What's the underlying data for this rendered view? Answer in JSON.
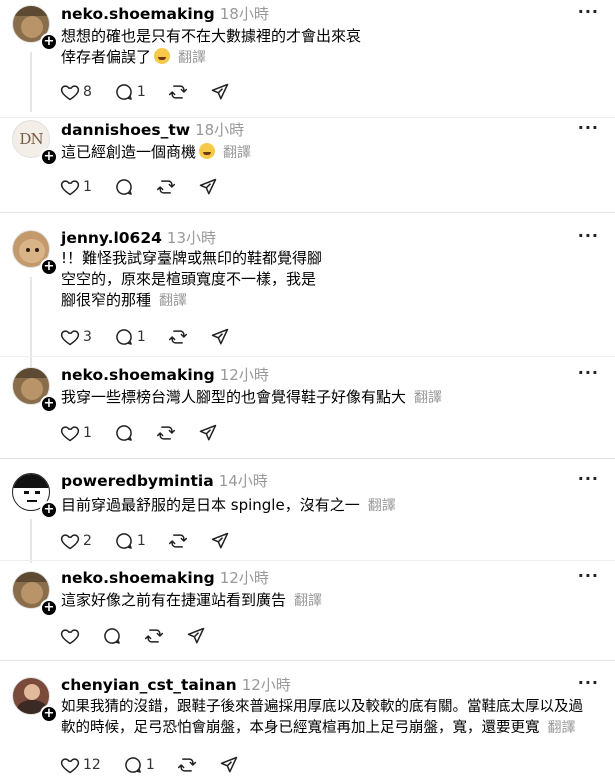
{
  "posts": [
    {
      "username": "neko.shoemaking",
      "time": "18小時",
      "lines": [
        "想想的確也是只有不在大數據裡的才會出來哀",
        "倖存者偏誤了"
      ],
      "emoji_after_last_line": true,
      "translate": "翻譯",
      "likes": "8",
      "comments": "1",
      "avatar": "cat-photo",
      "avatar_color": "#8a6d4b"
    },
    {
      "username": "dannishoes_tw",
      "time": "18小時",
      "lines": [
        "這已經創造一個商機"
      ],
      "emoji_after_last_line": true,
      "translate": "翻譯",
      "likes": "1",
      "comments": "",
      "avatar": "DN-logo",
      "avatar_text": "DN",
      "avatar_color": "#f3eee8"
    },
    {
      "username": "jenny.l0624",
      "time": "13小時",
      "lines": [
        "!！難怪我試穿臺牌或無印的鞋都覺得腳",
        "空空的，原來是楦頭寬度不一樣，我是",
        "腳很窄的那種"
      ],
      "emoji_after_last_line": false,
      "translate": "翻譯",
      "likes": "3",
      "comments": "1",
      "avatar": "dog-photo",
      "avatar_color": "#c49a6c"
    },
    {
      "username": "neko.shoemaking",
      "time": "12小時",
      "lines": [
        "我穿一些標榜台灣人腳型的也會覺得鞋子好像有點大"
      ],
      "emoji_after_last_line": false,
      "translate": "翻譯",
      "likes": "1",
      "comments": "",
      "avatar": "cat-photo",
      "avatar_color": "#8a6d4b"
    },
    {
      "username": "poweredbymintia",
      "time": "14小時",
      "lines": [
        "目前穿過最舒服的是日本 spingle，沒有之一"
      ],
      "emoji_after_last_line": false,
      "translate": "翻譯",
      "likes": "2",
      "comments": "1",
      "avatar": "face-drawing",
      "avatar_color": "#111111"
    },
    {
      "username": "neko.shoemaking",
      "time": "12小時",
      "lines": [
        "這家好像之前有在捷運站看到廣告"
      ],
      "emoji_after_last_line": false,
      "translate": "翻譯",
      "likes": "",
      "comments": "",
      "avatar": "cat-photo",
      "avatar_color": "#8a6d4b"
    },
    {
      "username": "chenyian_cst_tainan",
      "time": "12小時",
      "lines": [
        "如果我猜的沒錯，跟鞋子後來普遍採用厚底以及較軟的底有關。當鞋底太厚以及過",
        "軟的時候，足弓恐怕會崩盤，本身已經寬楦再加上足弓崩盤，寬，還要更寬"
      ],
      "emoji_after_last_line": false,
      "translate": "翻譯",
      "likes": "12",
      "comments": "1",
      "avatar": "person-photo",
      "avatar_color": "#7a4a3a"
    }
  ],
  "more_label": "···",
  "avatar_plus": "+",
  "icons": [
    "heart-icon",
    "comment-icon",
    "repost-icon",
    "share-icon",
    "more-icon"
  ]
}
